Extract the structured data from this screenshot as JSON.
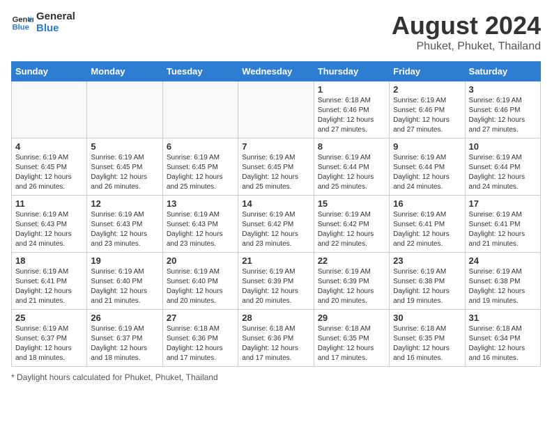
{
  "logo": {
    "line1": "General",
    "line2": "Blue"
  },
  "title": "August 2024",
  "subtitle": "Phuket, Phuket, Thailand",
  "days_of_week": [
    "Sunday",
    "Monday",
    "Tuesday",
    "Wednesday",
    "Thursday",
    "Friday",
    "Saturday"
  ],
  "footer": "Daylight hours",
  "weeks": [
    [
      {
        "day": "",
        "info": ""
      },
      {
        "day": "",
        "info": ""
      },
      {
        "day": "",
        "info": ""
      },
      {
        "day": "",
        "info": ""
      },
      {
        "day": "1",
        "info": "Sunrise: 6:18 AM\nSunset: 6:46 PM\nDaylight: 12 hours and 27 minutes."
      },
      {
        "day": "2",
        "info": "Sunrise: 6:19 AM\nSunset: 6:46 PM\nDaylight: 12 hours and 27 minutes."
      },
      {
        "day": "3",
        "info": "Sunrise: 6:19 AM\nSunset: 6:46 PM\nDaylight: 12 hours and 27 minutes."
      }
    ],
    [
      {
        "day": "4",
        "info": "Sunrise: 6:19 AM\nSunset: 6:45 PM\nDaylight: 12 hours and 26 minutes."
      },
      {
        "day": "5",
        "info": "Sunrise: 6:19 AM\nSunset: 6:45 PM\nDaylight: 12 hours and 26 minutes."
      },
      {
        "day": "6",
        "info": "Sunrise: 6:19 AM\nSunset: 6:45 PM\nDaylight: 12 hours and 25 minutes."
      },
      {
        "day": "7",
        "info": "Sunrise: 6:19 AM\nSunset: 6:45 PM\nDaylight: 12 hours and 25 minutes."
      },
      {
        "day": "8",
        "info": "Sunrise: 6:19 AM\nSunset: 6:44 PM\nDaylight: 12 hours and 25 minutes."
      },
      {
        "day": "9",
        "info": "Sunrise: 6:19 AM\nSunset: 6:44 PM\nDaylight: 12 hours and 24 minutes."
      },
      {
        "day": "10",
        "info": "Sunrise: 6:19 AM\nSunset: 6:44 PM\nDaylight: 12 hours and 24 minutes."
      }
    ],
    [
      {
        "day": "11",
        "info": "Sunrise: 6:19 AM\nSunset: 6:43 PM\nDaylight: 12 hours and 24 minutes."
      },
      {
        "day": "12",
        "info": "Sunrise: 6:19 AM\nSunset: 6:43 PM\nDaylight: 12 hours and 23 minutes."
      },
      {
        "day": "13",
        "info": "Sunrise: 6:19 AM\nSunset: 6:43 PM\nDaylight: 12 hours and 23 minutes."
      },
      {
        "day": "14",
        "info": "Sunrise: 6:19 AM\nSunset: 6:42 PM\nDaylight: 12 hours and 23 minutes."
      },
      {
        "day": "15",
        "info": "Sunrise: 6:19 AM\nSunset: 6:42 PM\nDaylight: 12 hours and 22 minutes."
      },
      {
        "day": "16",
        "info": "Sunrise: 6:19 AM\nSunset: 6:41 PM\nDaylight: 12 hours and 22 minutes."
      },
      {
        "day": "17",
        "info": "Sunrise: 6:19 AM\nSunset: 6:41 PM\nDaylight: 12 hours and 21 minutes."
      }
    ],
    [
      {
        "day": "18",
        "info": "Sunrise: 6:19 AM\nSunset: 6:41 PM\nDaylight: 12 hours and 21 minutes."
      },
      {
        "day": "19",
        "info": "Sunrise: 6:19 AM\nSunset: 6:40 PM\nDaylight: 12 hours and 21 minutes."
      },
      {
        "day": "20",
        "info": "Sunrise: 6:19 AM\nSunset: 6:40 PM\nDaylight: 12 hours and 20 minutes."
      },
      {
        "day": "21",
        "info": "Sunrise: 6:19 AM\nSunset: 6:39 PM\nDaylight: 12 hours and 20 minutes."
      },
      {
        "day": "22",
        "info": "Sunrise: 6:19 AM\nSunset: 6:39 PM\nDaylight: 12 hours and 20 minutes."
      },
      {
        "day": "23",
        "info": "Sunrise: 6:19 AM\nSunset: 6:38 PM\nDaylight: 12 hours and 19 minutes."
      },
      {
        "day": "24",
        "info": "Sunrise: 6:19 AM\nSunset: 6:38 PM\nDaylight: 12 hours and 19 minutes."
      }
    ],
    [
      {
        "day": "25",
        "info": "Sunrise: 6:19 AM\nSunset: 6:37 PM\nDaylight: 12 hours and 18 minutes."
      },
      {
        "day": "26",
        "info": "Sunrise: 6:19 AM\nSunset: 6:37 PM\nDaylight: 12 hours and 18 minutes."
      },
      {
        "day": "27",
        "info": "Sunrise: 6:18 AM\nSunset: 6:36 PM\nDaylight: 12 hours and 17 minutes."
      },
      {
        "day": "28",
        "info": "Sunrise: 6:18 AM\nSunset: 6:36 PM\nDaylight: 12 hours and 17 minutes."
      },
      {
        "day": "29",
        "info": "Sunrise: 6:18 AM\nSunset: 6:35 PM\nDaylight: 12 hours and 17 minutes."
      },
      {
        "day": "30",
        "info": "Sunrise: 6:18 AM\nSunset: 6:35 PM\nDaylight: 12 hours and 16 minutes."
      },
      {
        "day": "31",
        "info": "Sunrise: 6:18 AM\nSunset: 6:34 PM\nDaylight: 12 hours and 16 minutes."
      }
    ]
  ]
}
